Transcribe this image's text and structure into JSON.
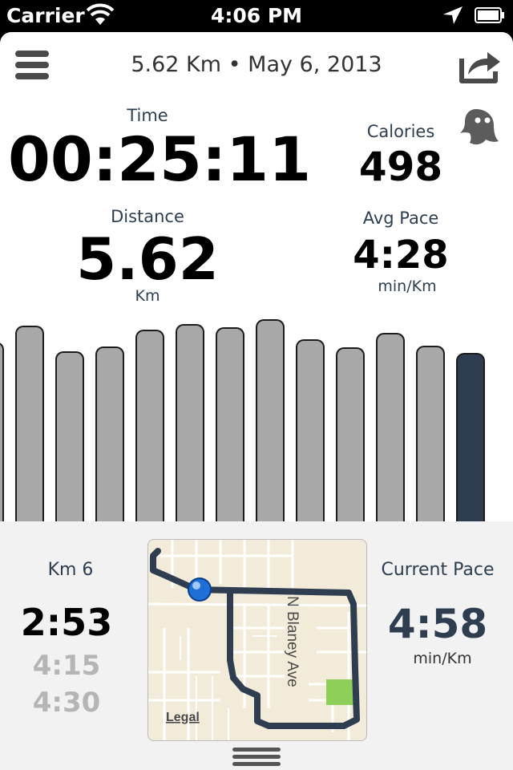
{
  "status_bar": {
    "carrier": "Carrier",
    "time": "4:06 PM"
  },
  "header": {
    "title": "5.62 Km • May 6, 2013"
  },
  "stats": {
    "time": {
      "label": "Time",
      "value": "00:25:11"
    },
    "calories": {
      "label": "Calories",
      "value": "498"
    },
    "distance": {
      "label": "Distance",
      "value": "5.62",
      "unit": "Km"
    },
    "avg_pace": {
      "label": "Avg Pace",
      "value": "4:28",
      "unit": "min/Km"
    }
  },
  "chart_data": {
    "type": "bar",
    "values": [
      224,
      244,
      212,
      218,
      239,
      246,
      242,
      252,
      227,
      217,
      235,
      219,
      210
    ],
    "highlighted_index": 12,
    "colors": {
      "bar": "#a8a8a8",
      "highlight": "#2e3e50",
      "outline": "#1c1c1c"
    }
  },
  "split": {
    "label": "Km 6",
    "current": "2:53",
    "previous": [
      "4:15",
      "4:30"
    ]
  },
  "current_pace": {
    "label": "Current Pace",
    "value": "4:58",
    "unit": "min/Km"
  },
  "map": {
    "street_label": "N Blaney Ave",
    "legal_link": "Legal"
  },
  "icons": [
    "menu-icon",
    "share-icon",
    "ghost-icon",
    "wifi-icon",
    "location-arrow-icon",
    "battery-icon",
    "drawer-handle-icon"
  ],
  "colors": {
    "accent": "#2e3e50",
    "label": "#2d3e50",
    "muted": "#b5b5b5"
  }
}
